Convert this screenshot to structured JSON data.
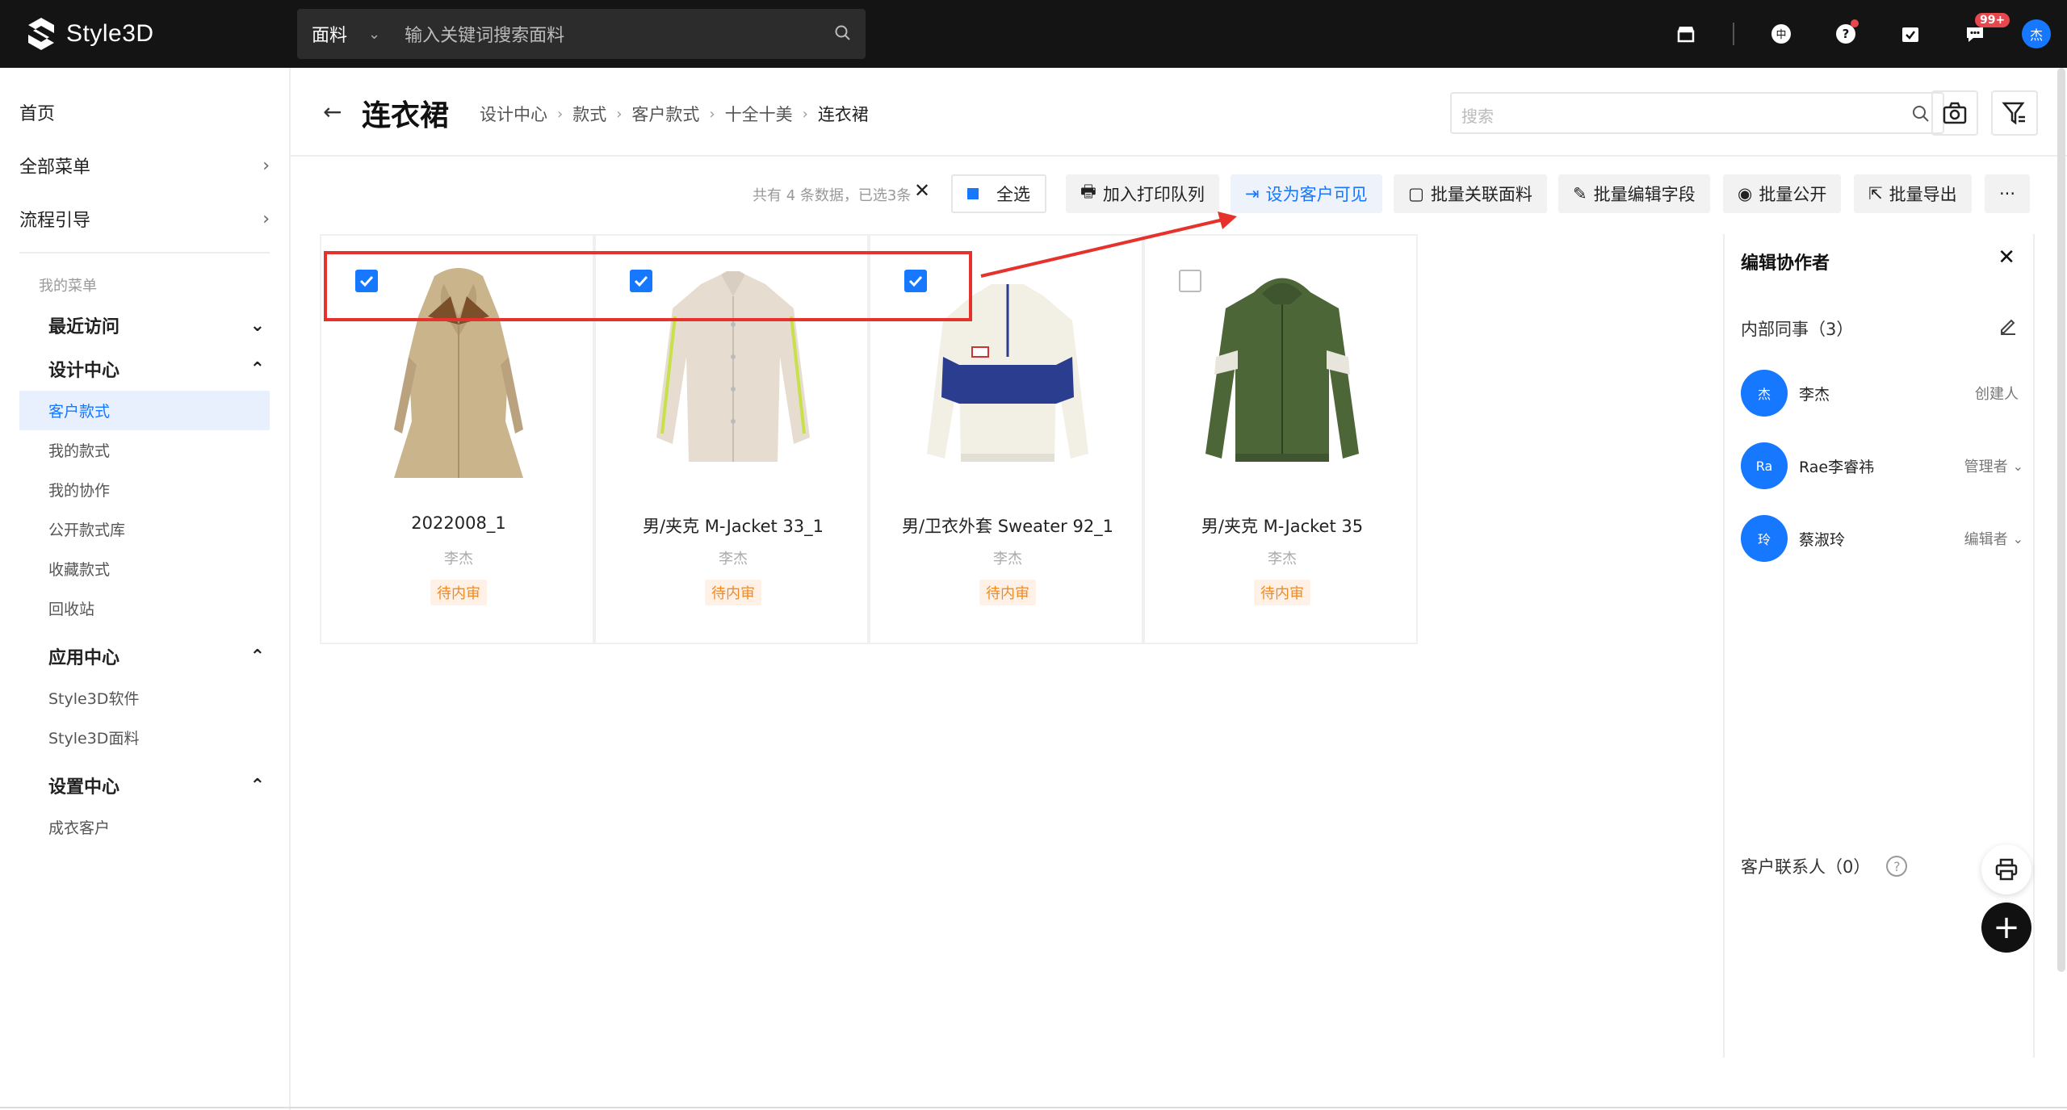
{
  "app": {
    "name": "Style3D"
  },
  "topbar": {
    "category": "面料",
    "search_placeholder": "输入关键词搜索面料",
    "notification_badge": "99+",
    "avatar_text": "杰",
    "icons": [
      "store-icon",
      "currency-icon",
      "help-icon",
      "task-icon",
      "message-icon"
    ]
  },
  "sidebar": {
    "top_items": [
      {
        "label": "首页"
      },
      {
        "label": "全部菜单"
      },
      {
        "label": "流程引导"
      }
    ],
    "my_menu_title": "我的菜单",
    "groups": [
      {
        "label": "最近访问",
        "expanded": false,
        "items": []
      },
      {
        "label": "设计中心",
        "expanded": true,
        "items": [
          {
            "label": "客户款式",
            "active": true
          },
          {
            "label": "我的款式"
          },
          {
            "label": "我的协作"
          },
          {
            "label": "公开款式库"
          },
          {
            "label": "收藏款式"
          },
          {
            "label": "回收站"
          }
        ]
      },
      {
        "label": "应用中心",
        "expanded": true,
        "items": [
          {
            "label": "Style3D软件"
          },
          {
            "label": "Style3D面料"
          }
        ]
      },
      {
        "label": "设置中心",
        "expanded": true,
        "items": [
          {
            "label": "成衣客户"
          }
        ]
      }
    ]
  },
  "header": {
    "title": "连衣裙",
    "breadcrumb": [
      "设计中心",
      "款式",
      "客户款式",
      "十全十美",
      "连衣裙"
    ],
    "search_placeholder": "搜索"
  },
  "toolbar": {
    "count_text": "共有 4 条数据，已选3条",
    "buttons": {
      "select_all": "全选",
      "print_queue": "加入打印队列",
      "set_visible": "设为客户可见",
      "link_fabric": "批量关联面料",
      "edit_fields": "批量编辑字段",
      "make_public": "批量公开",
      "export": "批量导出",
      "more": "···"
    }
  },
  "cards": [
    {
      "name": "2022008_1",
      "owner": "李杰",
      "status": "待内审",
      "checked": true,
      "garment": "dress"
    },
    {
      "name": "男/夹克 M-Jacket 33_1",
      "owner": "李杰",
      "status": "待内审",
      "checked": true,
      "garment": "shirt-jacket"
    },
    {
      "name": "男/卫衣外套 Sweater 92_1",
      "owner": "李杰",
      "status": "待内审",
      "checked": true,
      "garment": "sweater"
    },
    {
      "name": "男/夹克 M-Jacket 35",
      "owner": "李杰",
      "status": "待内审",
      "checked": false,
      "garment": "green-jacket"
    }
  ],
  "panel": {
    "title": "编辑协作者",
    "internal_title": "内部同事（3）",
    "members": [
      {
        "avatar": "杰",
        "name": "李杰",
        "role": "创建人"
      },
      {
        "avatar": "Ra",
        "name": "Rae李睿祎",
        "role": "管理者"
      },
      {
        "avatar": "玲",
        "name": "蔡淑玲",
        "role": "编辑者"
      }
    ],
    "client_contacts": "客户联系人（0）"
  },
  "colors": {
    "accent": "#1677ff",
    "topbar_bg": "#141414",
    "annotation_red": "#e5322d",
    "status_orange": "#f08a24"
  }
}
